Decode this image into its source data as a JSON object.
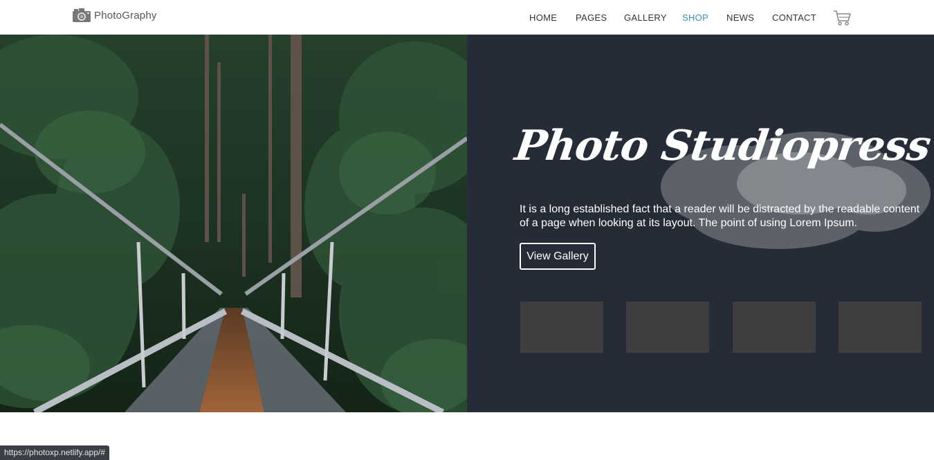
{
  "header": {
    "logo_text": "PhotoGraphy",
    "logo_icon": "camera-icon",
    "nav": [
      {
        "label": "HOME",
        "active": false
      },
      {
        "label": "PAGES",
        "active": false
      },
      {
        "label": "GALLERY",
        "active": false
      },
      {
        "label": "SHOP",
        "active": true
      },
      {
        "label": "NEWS",
        "active": false
      },
      {
        "label": "CONTACT",
        "active": false
      }
    ],
    "cart_icon": "cart-icon"
  },
  "hero": {
    "title": "Photo Studiopress",
    "description": "It is a long established fact that a reader will be distracted by the readable content of a page when looking at its layout. The point of using Lorem Ipsum.",
    "button_label": "View Gallery",
    "thumbnails_count": 4
  },
  "status_bar": {
    "url": "https://photoxp.netlify.app/#"
  },
  "colors": {
    "panel_bg": "#262c37",
    "nav_active": "#3a8fc0",
    "nav_text": "#333333",
    "thumb_bg": "#3e3e3e"
  }
}
